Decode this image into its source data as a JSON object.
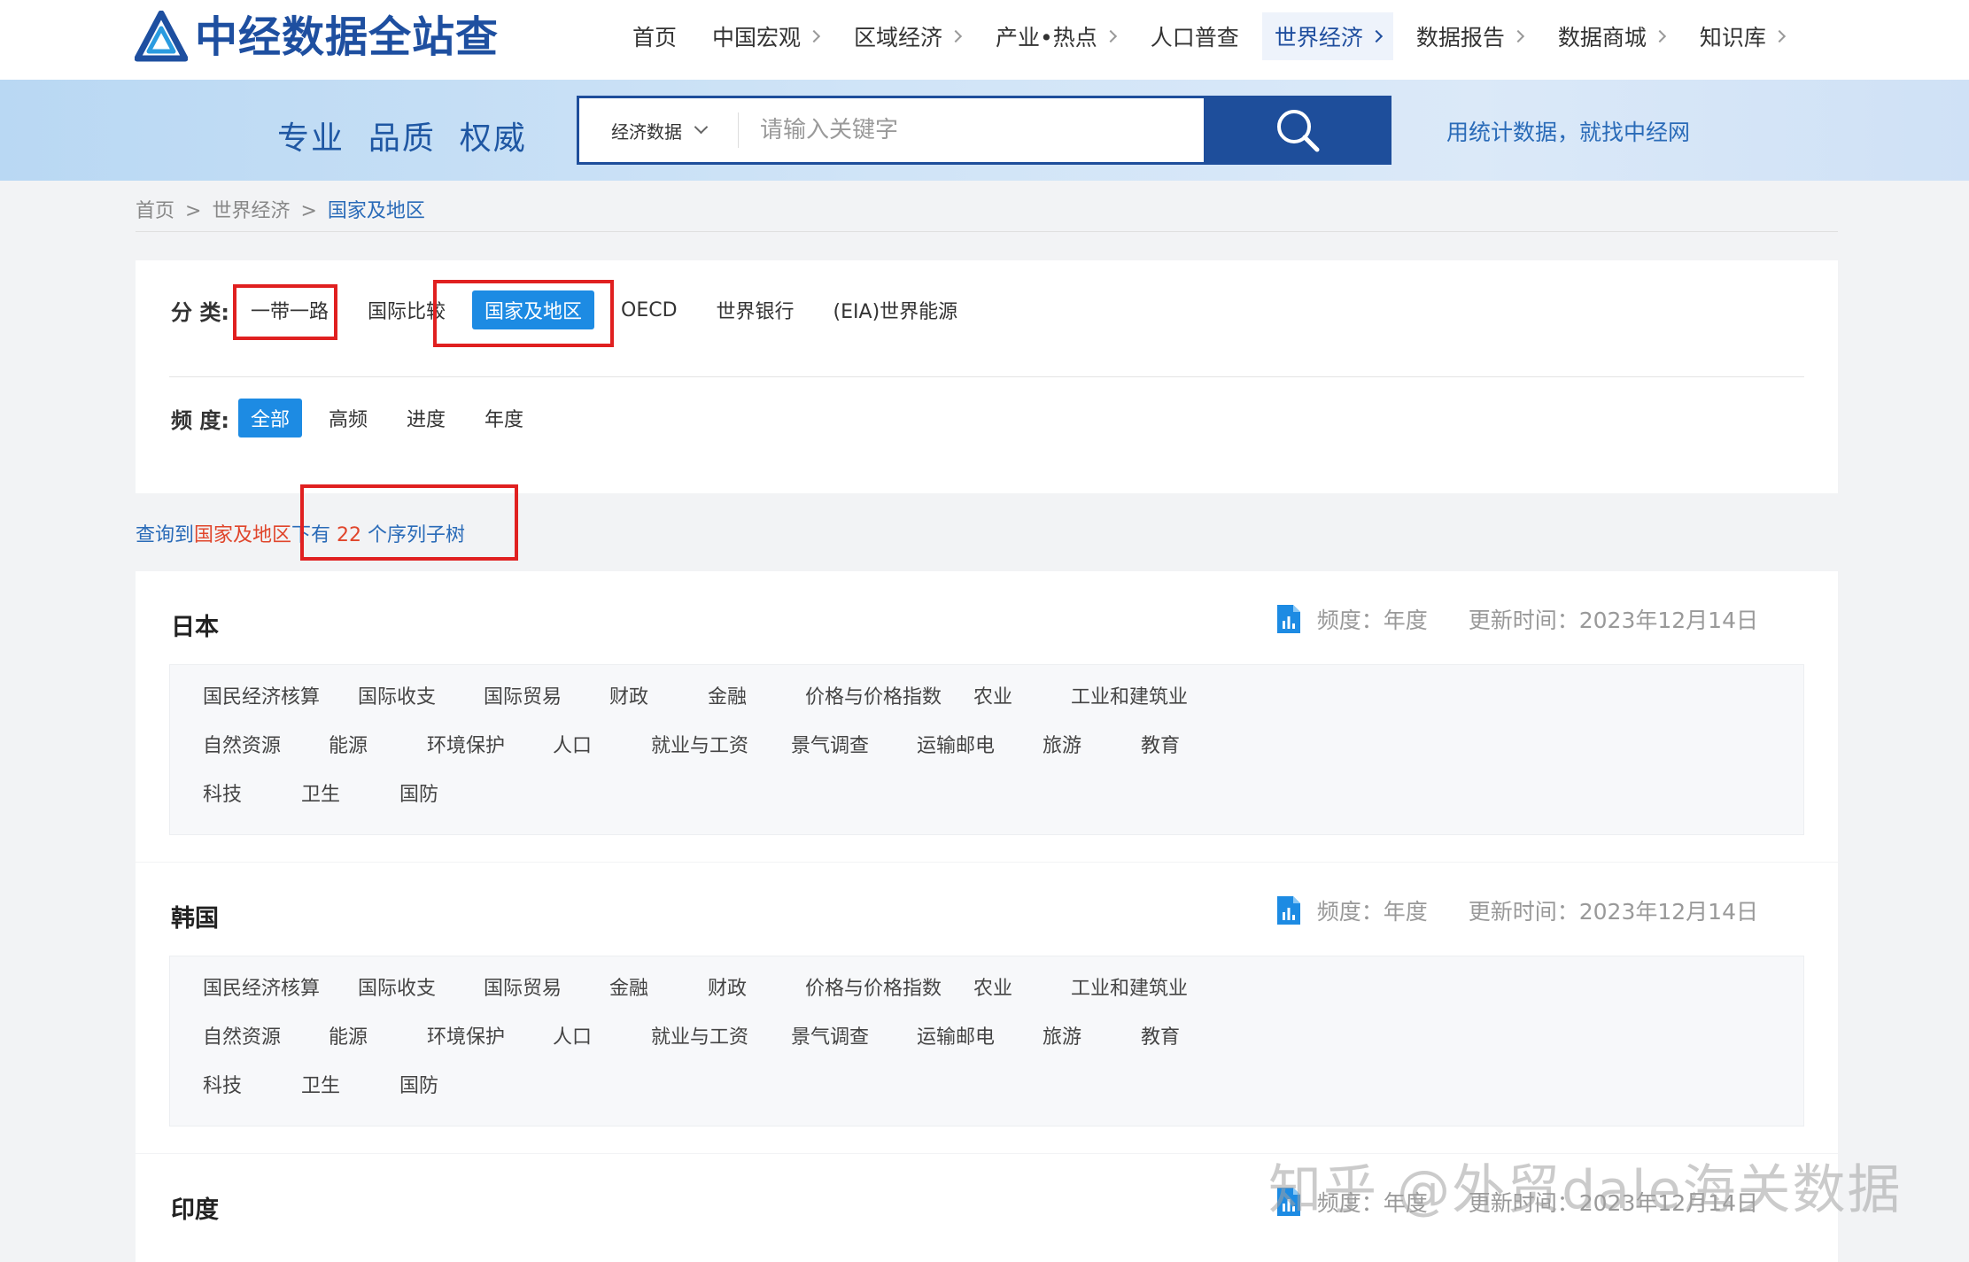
{
  "header": {
    "logo_text": "中经数据全站查",
    "nav": [
      {
        "label": "首页",
        "chevron": false
      },
      {
        "label": "中国宏观",
        "chevron": true
      },
      {
        "label": "区域经济",
        "chevron": true
      },
      {
        "label": "产业•热点",
        "chevron": true
      },
      {
        "label": "人口普查",
        "chevron": false
      },
      {
        "label": "世界经济",
        "chevron": true,
        "active": true
      },
      {
        "label": "数据报告",
        "chevron": true
      },
      {
        "label": "数据商城",
        "chevron": true
      },
      {
        "label": "知识库",
        "chevron": true
      }
    ]
  },
  "banner": {
    "slogan": "专业  品质  权威",
    "search_type": "经济数据",
    "search_placeholder": "请输入关键字",
    "tagline": "用统计数据，就找中经网"
  },
  "breadcrumb": [
    "首页",
    "世界经济",
    "国家及地区"
  ],
  "filters": {
    "category_label": "分 类:",
    "categories": [
      "一带一路",
      "国际比较",
      "国家及地区",
      "OECD",
      "世界银行",
      "(EIA)世界能源"
    ],
    "category_selected": 2,
    "frequency_label": "频 度:",
    "frequencies": [
      "全部",
      "高频",
      "进度",
      "年度"
    ],
    "frequency_selected": 0
  },
  "result": {
    "prefix": "查询到",
    "name": "国家及地区",
    "middle": "下有",
    "count": "22",
    "suffix": " 个序列子树"
  },
  "cards": [
    {
      "title": "日本",
      "freq": "频度：年度",
      "updated": "更新时间：2023年12月14日",
      "rows": [
        [
          "国民经济核算",
          "国际收支",
          "国际贸易",
          "财政",
          "金融",
          "价格与价格指数",
          "农业",
          "工业和建筑业"
        ],
        [
          "自然资源",
          "能源",
          "环境保护",
          "人口",
          "就业与工资",
          "景气调查",
          "运输邮电",
          "旅游",
          "教育"
        ],
        [
          "科技",
          "卫生",
          "国防"
        ]
      ]
    },
    {
      "title": "韩国",
      "freq": "频度：年度",
      "updated": "更新时间：2023年12月14日",
      "rows": [
        [
          "国民经济核算",
          "国际收支",
          "国际贸易",
          "金融",
          "财政",
          "价格与价格指数",
          "农业",
          "工业和建筑业"
        ],
        [
          "自然资源",
          "能源",
          "环境保护",
          "人口",
          "就业与工资",
          "景气调查",
          "运输邮电",
          "旅游",
          "教育"
        ],
        [
          "科技",
          "卫生",
          "国防"
        ]
      ]
    },
    {
      "title": "印度",
      "freq": "频度：年度",
      "updated": "更新时间：2023年12月14日",
      "rows": []
    }
  ],
  "colors": {
    "brand": "#1e4fa0",
    "accent": "#1d8be3",
    "highlight_box": "#e02020"
  },
  "watermark": "知乎 @外贸dale海关数据"
}
